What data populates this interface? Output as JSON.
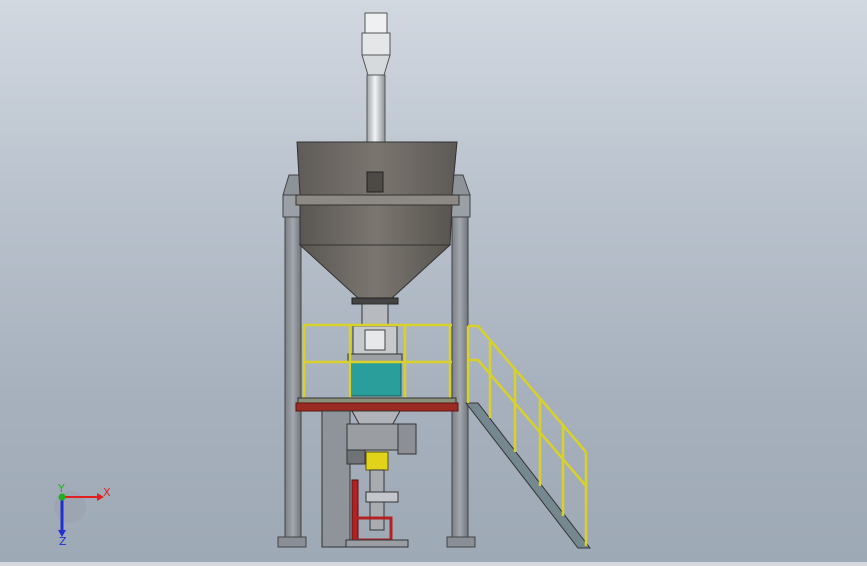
{
  "viewport": {
    "background_top": "#d2d8e0",
    "background_bottom": "#9ea9b6"
  },
  "model": {
    "description_icon": "cad-3d-model",
    "colors": {
      "hopper": "#6f6a66",
      "frame": "#8b8f96",
      "railing": "#d9d02a",
      "platform_beam": "#9b2a22",
      "teal_box": "#2a9e9a",
      "yellow_part": "#e2d21a",
      "red_frame": "#b32222"
    }
  },
  "triad": {
    "x_label": "X",
    "y_label": "Y",
    "z_label": "Z",
    "x_color": "#e02020",
    "y_color": "#20b020",
    "z_color": "#2030d0"
  }
}
